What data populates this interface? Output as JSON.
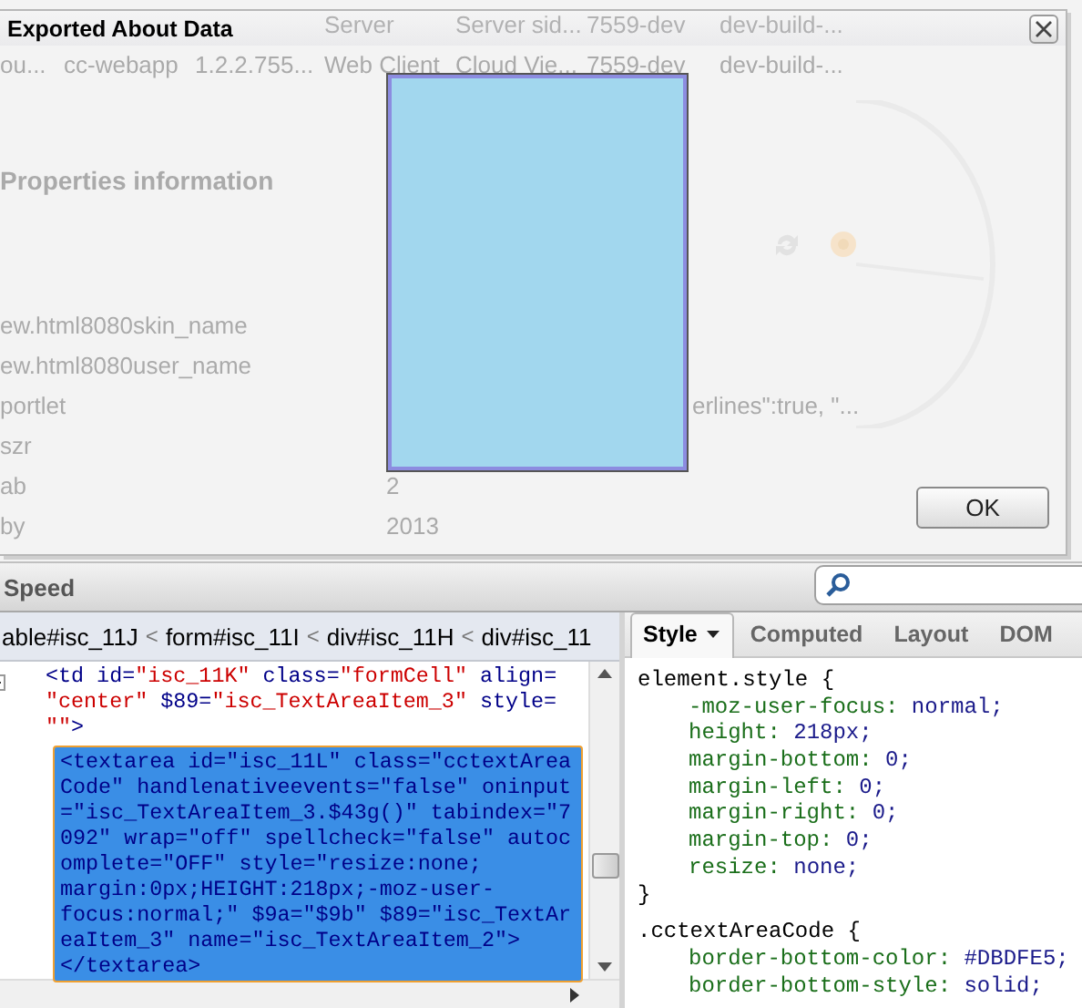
{
  "background_page": {
    "table_rows": [
      [
        "Server",
        "Server sid...",
        "7559-dev",
        "dev-build-..."
      ],
      [
        "ou...",
        "cc-webapp",
        "1.2.2.755...",
        "Web Client",
        "Cloud Vie...",
        "7559-dev",
        "dev-build-..."
      ]
    ],
    "section_title": "Properties information",
    "properties": [
      {
        "name": "ew.html8080skin_name"
      },
      {
        "name": "ew.html8080user_name"
      },
      {
        "name": "portlet",
        "note": "erlines\":true, \"..."
      },
      {
        "name": "szr"
      },
      {
        "name": "ab",
        "value": "2"
      },
      {
        "name": "by",
        "value": "2013"
      }
    ]
  },
  "dialog": {
    "title": "Exported About Data",
    "ok_button": "OK"
  },
  "firebug": {
    "toolbar": {
      "label": "Speed"
    },
    "breadcrumbs": {
      "separator": "<",
      "items": [
        "able#isc_11J",
        "form#isc_11I",
        "div#isc_11H",
        "div#isc_11"
      ]
    },
    "html_lines": [
      {
        "selected": false,
        "tokens": [
          {
            "kind": "tag",
            "text": "<td"
          },
          {
            "kind": "attr",
            "text": " id="
          },
          {
            "kind": "value",
            "text": "\"isc_11K\""
          },
          {
            "kind": "attr",
            "text": " class="
          },
          {
            "kind": "value",
            "text": "\"formCell\""
          },
          {
            "kind": "attr",
            "text": " align="
          }
        ]
      },
      {
        "selected": false,
        "tokens": [
          {
            "kind": "value",
            "text": "\"center\""
          },
          {
            "kind": "attr",
            "text": " $89="
          },
          {
            "kind": "value",
            "text": "\"isc_TextAreaItem_3\""
          },
          {
            "kind": "attr",
            "text": " style="
          }
        ]
      },
      {
        "selected": false,
        "tokens": [
          {
            "kind": "value",
            "text": "\"\""
          },
          {
            "kind": "tag",
            "text": ">"
          }
        ]
      },
      {
        "selected": true,
        "tokens": [
          {
            "kind": "tag",
            "text": "<textarea id=\"isc_11L\" class=\"cctextArea"
          }
        ]
      },
      {
        "selected": true,
        "tokens": [
          {
            "kind": "tag",
            "text": "Code\" handlenativeevents=\"false\" oninput"
          }
        ]
      },
      {
        "selected": true,
        "tokens": [
          {
            "kind": "tag",
            "text": "=\"isc_TextAreaItem_3.$43g()\" tabindex=\"7"
          }
        ]
      },
      {
        "selected": true,
        "tokens": [
          {
            "kind": "tag",
            "text": "092\" wrap=\"off\" spellcheck=\"false\" autoc"
          }
        ]
      },
      {
        "selected": true,
        "tokens": [
          {
            "kind": "tag",
            "text": "omplete=\"OFF\" style=\"resize:none;"
          }
        ]
      },
      {
        "selected": true,
        "tokens": [
          {
            "kind": "tag",
            "text": "margin:0px;HEIGHT:218px;-moz-user-"
          }
        ]
      },
      {
        "selected": true,
        "tokens": [
          {
            "kind": "tag",
            "text": "focus:normal;\" $9a=\"$9b\" $89=\"isc_TextAr"
          }
        ]
      },
      {
        "selected": true,
        "tokens": [
          {
            "kind": "tag",
            "text": "eaItem_3\" name=\"isc_TextAreaItem_2\">"
          }
        ]
      },
      {
        "selected": true,
        "tokens": [
          {
            "kind": "tag",
            "text": "</textarea>"
          }
        ]
      }
    ],
    "side_tabs": [
      {
        "label": "Style",
        "selected": true
      },
      {
        "label": "Computed",
        "selected": false
      },
      {
        "label": "Layout",
        "selected": false
      },
      {
        "label": "DOM",
        "selected": false
      }
    ],
    "css_rules": [
      {
        "selector": "element.style",
        "open": "{",
        "close": "}",
        "properties": [
          {
            "name": "-moz-user-focus:",
            "value": "normal;"
          },
          {
            "name": "height:",
            "value": "218px;"
          },
          {
            "name": "margin-bottom:",
            "value": "0;"
          },
          {
            "name": "margin-left:",
            "value": "0;"
          },
          {
            "name": "margin-right:",
            "value": "0;"
          },
          {
            "name": "margin-top:",
            "value": "0;"
          },
          {
            "name": "resize:",
            "value": "none;"
          }
        ]
      },
      {
        "selector": ".cctextAreaCode",
        "open": "{",
        "properties": [
          {
            "name": "border-bottom-color:",
            "value": "#DBDFE5;"
          },
          {
            "name": "border-bottom-style:",
            "value": "solid;"
          }
        ]
      }
    ]
  }
}
